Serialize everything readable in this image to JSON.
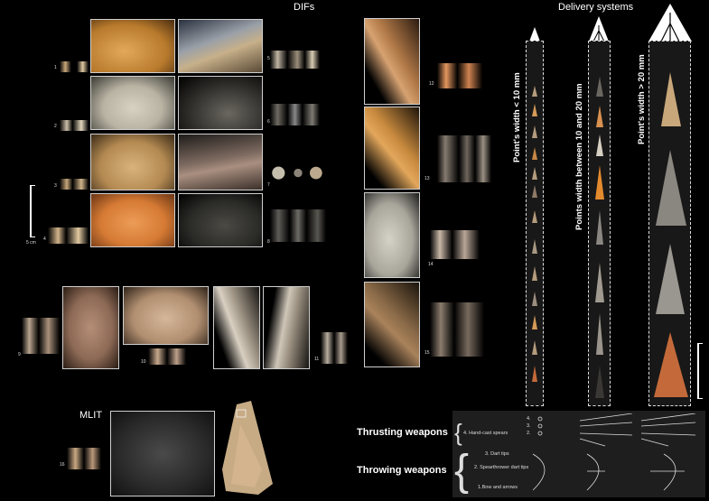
{
  "titles": {
    "difs": "DIFs",
    "delivery": "Delivery systems",
    "mlit": "MLIT"
  },
  "numbers": [
    "1",
    "2",
    "3",
    "4",
    "5",
    "6",
    "7",
    "8",
    "9",
    "10",
    "11",
    "12",
    "13",
    "14",
    "15",
    "16"
  ],
  "scale_label": "5 cm",
  "columns": [
    {
      "label": "Point's width < 10 mm"
    },
    {
      "label": "Points width between 10 and 20 mm"
    },
    {
      "label": "Point's width > 20 mm"
    }
  ],
  "legend": {
    "thrusting": "Thrusting weapons",
    "throwing": "Throwing weapons",
    "items": [
      "4. Hand-cast spears",
      "3. Dart tips",
      "2. Spearthrower dart tips",
      "1.Bow and arrows"
    ],
    "markers": [
      "4.",
      "3.",
      "2.",
      "1."
    ]
  },
  "colors": {
    "background": "#000000",
    "stone_light": "#c8a77a",
    "stone_orange": "#d88b3a",
    "stone_grey": "#8a8680",
    "stone_dark": "#3a3835"
  }
}
